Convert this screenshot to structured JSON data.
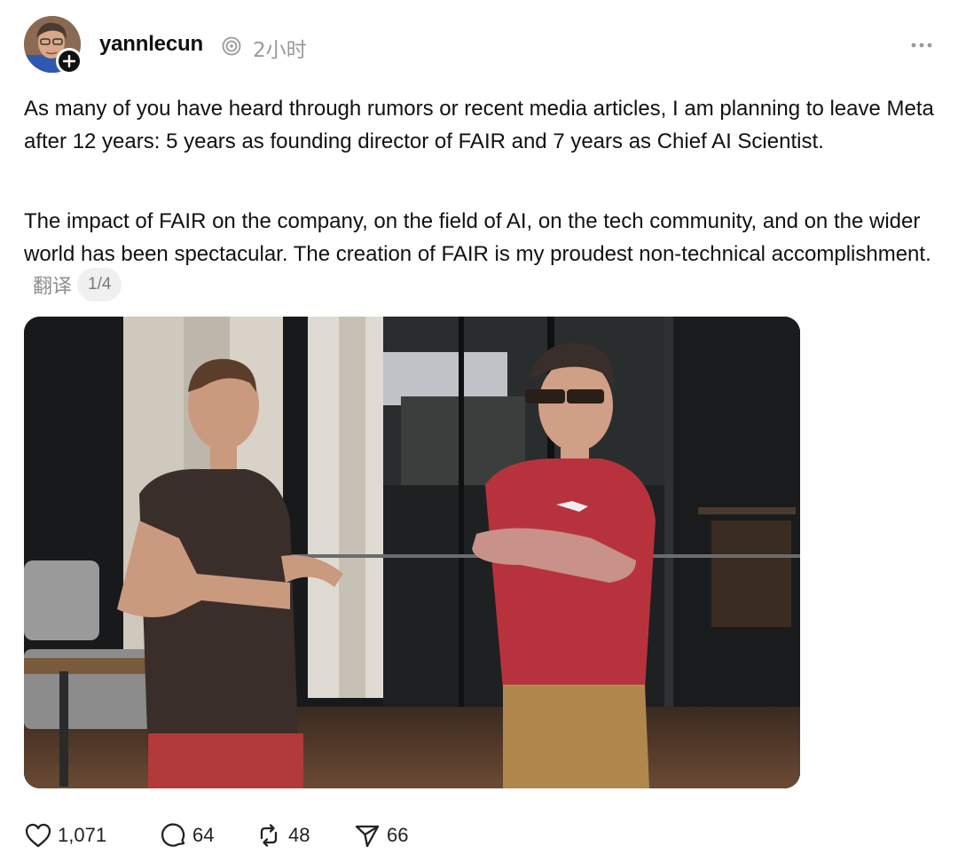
{
  "post": {
    "author": {
      "username": "yannlecun",
      "timestamp": "2小时"
    },
    "paragraphs": [
      "As many of you have heard through rumors or recent media articles, I am planning to leave Meta after 12 years: 5 years as founding director of FAIR and 7 years as Chief AI Scientist.",
      "The impact of FAIR on the company, on the field of AI, on the tech community, and on the wider world has been spectacular. The creation of FAIR is my proudest non-technical accomplishment."
    ],
    "translate_label": "翻译",
    "image_pager": "1/4",
    "actions": {
      "likes": "1,071",
      "replies": "64",
      "reposts": "48",
      "shares": "66"
    }
  },
  "icons": {
    "threads_badge": "threads-icon",
    "more": "more-icon",
    "follow": "plus-icon",
    "like": "heart-icon",
    "reply": "comment-icon",
    "repost": "repost-icon",
    "share": "send-icon"
  },
  "colors": {
    "text": "#111111",
    "muted": "#9a9a9a",
    "pill_bg": "#f0f0f0"
  }
}
